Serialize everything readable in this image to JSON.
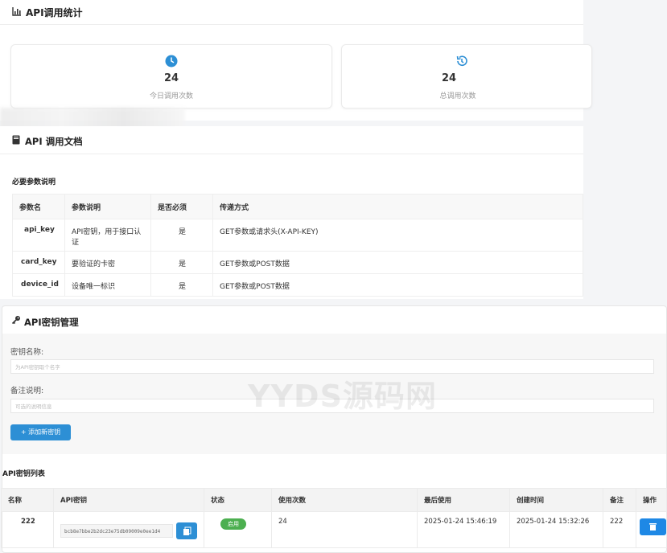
{
  "stats": {
    "title": "API调用统计",
    "today": {
      "value": "24",
      "label": "今日调用次数"
    },
    "total": {
      "value": "24",
      "label": "总调用次数"
    }
  },
  "docs": {
    "title": "API 调用文档",
    "section_title": "必要参数说明",
    "headers": [
      "参数名",
      "参数说明",
      "是否必须",
      "传递方式"
    ],
    "rows": [
      {
        "name": "api_key",
        "desc": "API密钥，用于接口认证",
        "required": "是",
        "method": "GET参数或请求头(X-API-KEY)"
      },
      {
        "name": "card_key",
        "desc": "要验证的卡密",
        "required": "是",
        "method": "GET参数或POST数据"
      },
      {
        "name": "device_id",
        "desc": "设备唯一标识",
        "required": "是",
        "method": "GET参数或POST数据"
      }
    ]
  },
  "keys": {
    "title": "API密钥管理",
    "name_label": "密钥名称:",
    "name_placeholder": "为API密钥取个名字",
    "note_label": "备注说明:",
    "note_placeholder": "可选的说明信息",
    "add_button": "+ 添加新密钥",
    "list_title": "API密钥列表",
    "headers": [
      "名称",
      "API密钥",
      "状态",
      "使用次数",
      "最后使用",
      "创建时间",
      "备注",
      "操作"
    ],
    "rows": [
      {
        "name": "222",
        "key": "bcb8e7bbe2b2dc23e75db09009e0ee1d4",
        "status": "启用",
        "count": "24",
        "last_used": "2025-01-24 15:46:19",
        "created": "2025-01-24 15:32:26",
        "note": "222"
      }
    ]
  },
  "watermark": "YYDS源码网",
  "colors": {
    "accent": "#2d8fd5",
    "success": "#4caf50",
    "primary_btn": "#1e88e5"
  }
}
